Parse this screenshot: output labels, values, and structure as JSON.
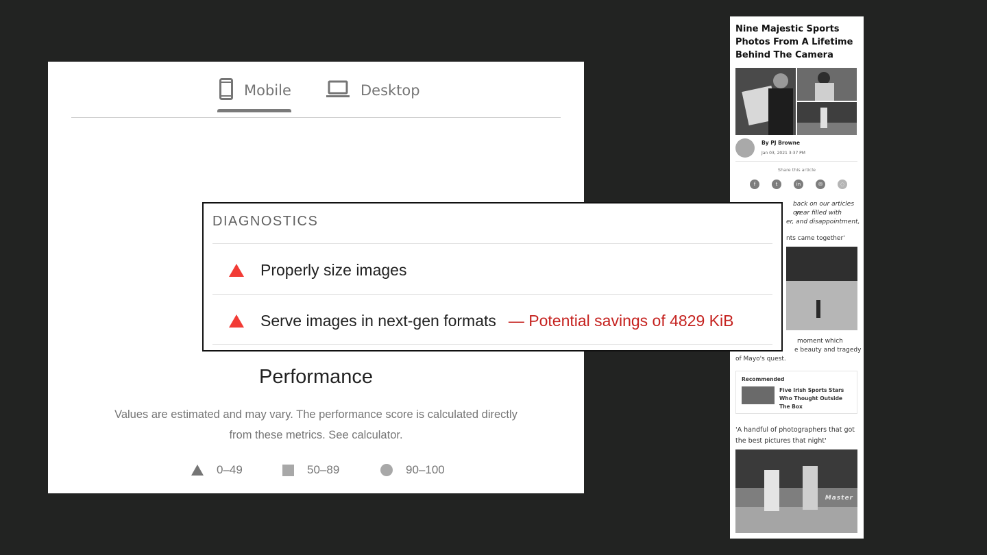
{
  "tabs": {
    "mobile_label": "Mobile",
    "desktop_label": "Desktop",
    "active": "Mobile",
    "mobile_icon": "phone-icon",
    "desktop_icon": "laptop-icon"
  },
  "performance": {
    "title": "Performance",
    "description": "Values are estimated and may vary. The performance score is calculated directly from these metrics. See calculator."
  },
  "legend": {
    "fail_range": "0–49",
    "average_range": "50–89",
    "pass_range": "90–100"
  },
  "diagnostics": {
    "title": "DIAGNOSTICS",
    "items": [
      {
        "label": "Properly size images",
        "savings": "",
        "icon": "warning-triangle-icon"
      },
      {
        "label": "Serve images in next-gen formats",
        "savings": "— Potential savings of 4829 KiB",
        "icon": "warning-triangle-icon"
      }
    ]
  },
  "article": {
    "title": "Nine Majestic Sports Photos From A Lifetime Behind The Camera",
    "author": "By PJ Browne",
    "date": "Jan 03, 2021 3:37 PM",
    "share_label": "Share this article",
    "share_icons": [
      "facebook-icon",
      "twitter-icon",
      "linkedin-icon",
      "email-icon",
      "whatsapp-icon"
    ],
    "intro_visible": "back on our articles on",
    "intro_line2": "year filled with",
    "intro_line3": "er, and disappointment,",
    "quote1_partial": "nts came together'",
    "caption_line1": "moment which",
    "caption_line2": "e beauty and tragedy",
    "caption_line3": "of Mayo's quest.",
    "recommended_label": "Recommended",
    "recommended_title": "Five Irish Sports Stars Who Thought Outside The Box",
    "quote2": "'A handful of photographers that got the best pictures that night'",
    "photo_watermark": "Master"
  },
  "colors": {
    "background": "#222322",
    "warning_red": "#f23b35",
    "savings_red": "#c5221f",
    "tab_grey": "#757575"
  }
}
